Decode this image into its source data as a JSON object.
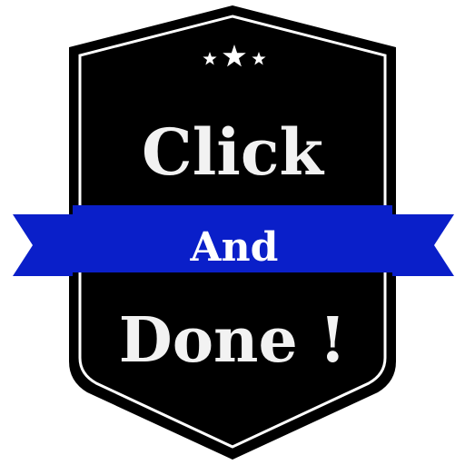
{
  "badge": {
    "title_top": "Click",
    "title_middle": "And",
    "title_bottom": "Done !",
    "stars": [
      "small-star",
      "large-star",
      "small-star"
    ]
  },
  "colors": {
    "shield_fill": "#000000",
    "shield_inner_border": "#ffffff",
    "shield_outer_border": "#000000",
    "ribbon_fill": "#0a1fc9",
    "ribbon_shadow": "#000d80",
    "text_light": "#f2f2f2",
    "text_ribbon": "#ffffff",
    "background": "#ffffff"
  }
}
